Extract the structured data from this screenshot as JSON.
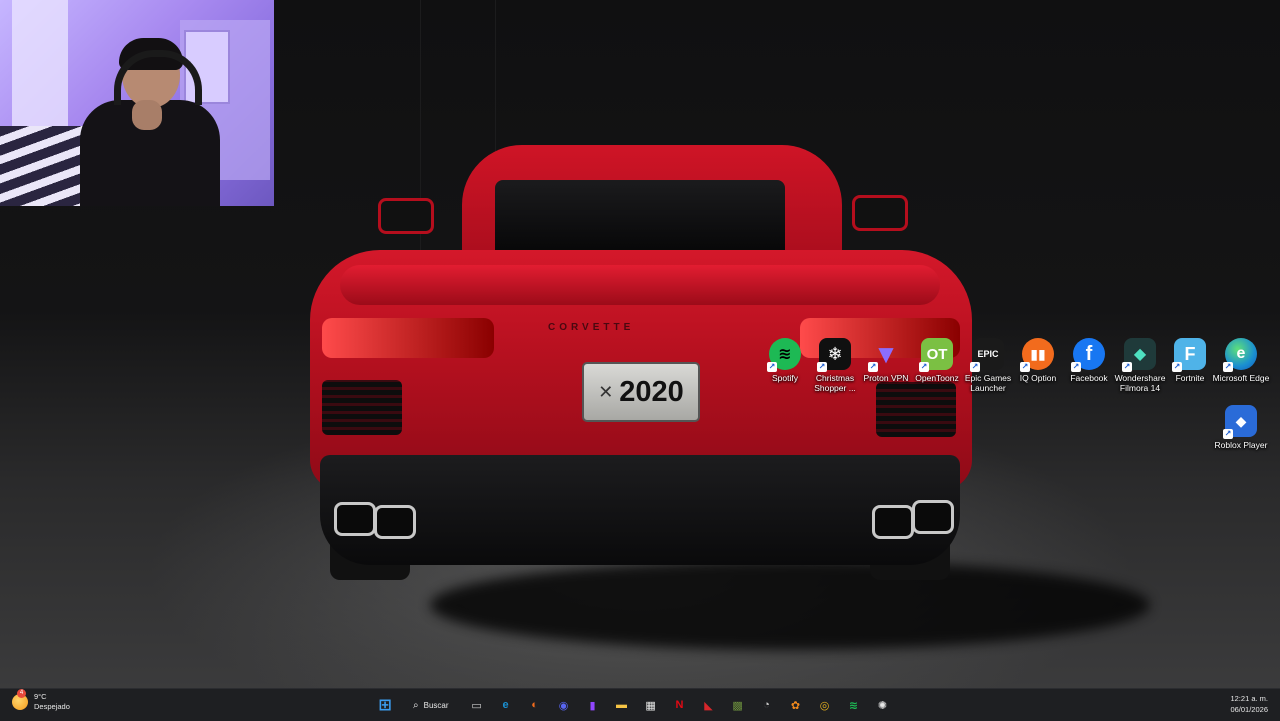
{
  "desktop": {
    "wallpaper": {
      "plate_text": "2020",
      "badge_text": "CORVETTE"
    },
    "icons": [
      {
        "label": "Spotify",
        "icon": "spotify-icon",
        "color": "#1db954"
      },
      {
        "label": "Christmas Shopper ...",
        "icon": "snowflake-icon",
        "color": "#101010"
      },
      {
        "label": "Proton VPN",
        "icon": "proton-vpn-icon",
        "color": "#6d4aff"
      },
      {
        "label": "OpenToonz",
        "icon": "opentoonz-icon",
        "color": "#7bc043"
      },
      {
        "label": "Epic Games Launcher",
        "icon": "epic-games-icon",
        "color": "#1a1a1a"
      },
      {
        "label": "IQ Option",
        "icon": "iq-option-icon",
        "color": "#f26b1d"
      },
      {
        "label": "Facebook",
        "icon": "facebook-icon",
        "color": "#1877f2"
      },
      {
        "label": "Wondershare Filmora 14",
        "icon": "filmora-icon",
        "color": "#1f3a3a"
      },
      {
        "label": "Fortnite",
        "icon": "fortnite-icon",
        "color": "#4fb3e8"
      },
      {
        "label": "Microsoft Edge",
        "icon": "edge-icon",
        "color": "#1a8fd1"
      },
      {
        "label": "Roblox Player",
        "icon": "roblox-icon",
        "color": "#2a6bd8"
      }
    ]
  },
  "taskbar": {
    "weather": {
      "temp": "9°C",
      "condition": "Despejado",
      "alert_count": "4"
    },
    "search_label": "Buscar",
    "apps": [
      {
        "name": "task-view-icon",
        "glyph": "▭",
        "color": "#c9c9c9"
      },
      {
        "name": "edge-taskbar-icon",
        "glyph": "e",
        "color": "#1a8fd1"
      },
      {
        "name": "orange-app-icon",
        "glyph": "◐",
        "color": "#f26b1d"
      },
      {
        "name": "discord-icon",
        "glyph": "◉",
        "color": "#5865f2"
      },
      {
        "name": "twitch-icon",
        "glyph": "▮",
        "color": "#9146ff"
      },
      {
        "name": "file-explorer-icon",
        "glyph": "▬",
        "color": "#f6c445"
      },
      {
        "name": "microsoft-store-icon",
        "glyph": "▦",
        "color": "#e8e8e8"
      },
      {
        "name": "netflix-icon",
        "glyph": "N",
        "color": "#e50914"
      },
      {
        "name": "amd-icon",
        "glyph": "◣",
        "color": "#d7262b"
      },
      {
        "name": "minecraft-icon",
        "glyph": "▩",
        "color": "#6b8e3d"
      },
      {
        "name": "speedometer-icon",
        "glyph": "◔",
        "color": "#c9c9c9"
      },
      {
        "name": "fl-studio-icon",
        "glyph": "✿",
        "color": "#f28a1d"
      },
      {
        "name": "chrome-icon",
        "glyph": "◎",
        "color": "#e8b21e"
      },
      {
        "name": "spotify-taskbar-icon",
        "glyph": "≋",
        "color": "#1db954"
      },
      {
        "name": "chatgpt-icon",
        "glyph": "✺",
        "color": "#e8e8e8"
      }
    ],
    "clock": {
      "time": "12:21 a. m.",
      "date": "06/01/2026"
    }
  }
}
